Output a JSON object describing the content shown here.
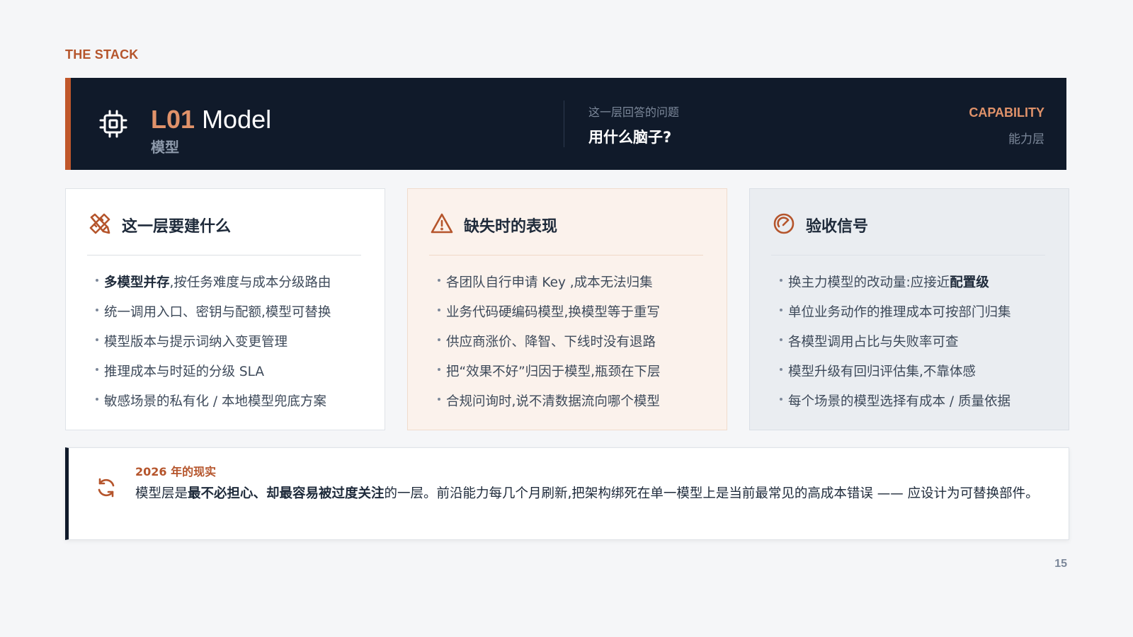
{
  "section_label": "THE STACK",
  "header": {
    "code": "L01",
    "name": "Model",
    "name_cn": "模型",
    "question_label": "这一层回答的问题",
    "question": "用什么脑子?",
    "category_en": "CAPABILITY",
    "category_cn": "能力层",
    "icon": "cpu-chip-icon"
  },
  "cards": [
    {
      "title": "这一层要建什么",
      "icon": "tools-icon",
      "items": [
        {
          "bold": "多模型并存",
          "text": ",按任务难度与成本分级路由"
        },
        {
          "text": "统一调用入口、密钥与配额,模型可替换"
        },
        {
          "text": "模型版本与提示词纳入变更管理"
        },
        {
          "text": "推理成本与时延的分级 SLA"
        },
        {
          "text": "敏感场景的私有化 / 本地模型兜底方案"
        }
      ]
    },
    {
      "title": "缺失时的表现",
      "icon": "warning-icon",
      "items": [
        {
          "text": "各团队自行申请 Key ,成本无法归集"
        },
        {
          "text": "业务代码硬编码模型,换模型等于重写"
        },
        {
          "text": "供应商涨价、降智、下线时没有退路"
        },
        {
          "text": "把“效果不好”归因于模型,瓶颈在下层"
        },
        {
          "text": "合规问询时,说不清数据流向哪个模型"
        }
      ]
    },
    {
      "title": "验收信号",
      "icon": "gauge-icon",
      "items": [
        {
          "text": "换主力模型的改动量:应接近",
          "bold_after": "配置级"
        },
        {
          "text": "单位业务动作的推理成本可按部门归集"
        },
        {
          "text": "各模型调用占比与失败率可查"
        },
        {
          "text": "模型升级有回归评估集,不靠体感"
        },
        {
          "text": "每个场景的模型选择有成本 / 质量依据"
        }
      ]
    }
  ],
  "reality": {
    "icon": "refresh-icon",
    "label": "2026 年的现实",
    "text_before": "模型层是",
    "text_bold": "最不必担心、却最容易被过度关注",
    "text_after": "的一层。前沿能力每几个月刷新,把架构绑死在单一模型上是当前最常见的高成本错误 —— 应设计为可替换部件。"
  },
  "page_number": "15",
  "colors": {
    "accent": "#c0572b",
    "accent_light": "#e0926a",
    "navy": "#101a2a",
    "card_warm": "#fbf2ec",
    "card_cool": "#eaedf1"
  }
}
